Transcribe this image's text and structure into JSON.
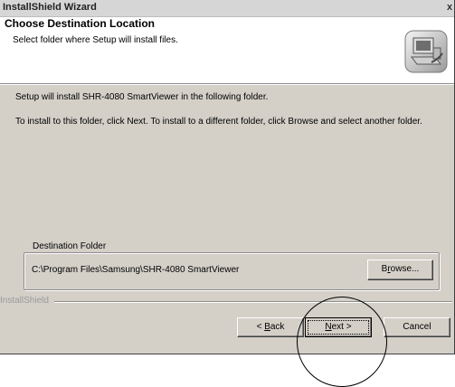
{
  "window": {
    "title": "InstallShield Wizard",
    "close_glyph": "x"
  },
  "header": {
    "title": "Choose Destination Location",
    "subtitle": "Select folder where Setup will install files.",
    "icon": "computer-setup-icon"
  },
  "body": {
    "line1": "Setup will install SHR-4080 SmartViewer in the following folder.",
    "line2": "To install to this folder, click Next. To install to a different folder, click Browse and select another folder."
  },
  "destination": {
    "group_label": "Destination Folder",
    "path": "C:\\Program Files\\Samsung\\SHR-4080 SmartViewer",
    "browse_label_pre": "B",
    "browse_label_access": "r",
    "browse_label_post": "owse..."
  },
  "footer": {
    "brand": "InstallShield",
    "back_pre": "< ",
    "back_access": "B",
    "back_post": "ack",
    "next_access": "N",
    "next_post": "ext >",
    "cancel_label": "Cancel"
  }
}
